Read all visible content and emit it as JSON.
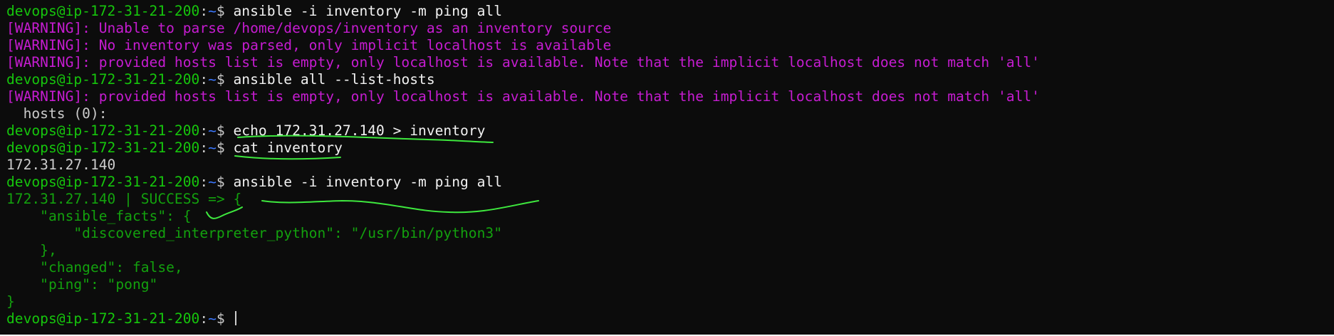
{
  "terminal": {
    "prompt": {
      "user_host": "devops@ip-172-31-21-200",
      "colon": ":",
      "path": "~",
      "dollar": "$ "
    },
    "lines": [
      {
        "kind": "prompt",
        "command": "ansible -i inventory -m ping all"
      },
      {
        "kind": "warning",
        "text": "[WARNING]: Unable to parse /home/devops/inventory as an inventory source"
      },
      {
        "kind": "warning",
        "text": "[WARNING]: No inventory was parsed, only implicit localhost is available"
      },
      {
        "kind": "warning",
        "text": "[WARNING]: provided hosts list is empty, only localhost is available. Note that the implicit localhost does not match 'all'"
      },
      {
        "kind": "prompt",
        "command": "ansible all --list-hosts"
      },
      {
        "kind": "warning",
        "text": "[WARNING]: provided hosts list is empty, only localhost is available. Note that the implicit localhost does not match 'all'"
      },
      {
        "kind": "output",
        "text": "  hosts (0):"
      },
      {
        "kind": "prompt",
        "command": "echo 172.31.27.140 > inventory"
      },
      {
        "kind": "prompt",
        "command": "cat inventory"
      },
      {
        "kind": "output",
        "text": "172.31.27.140"
      },
      {
        "kind": "prompt",
        "command": "ansible -i inventory -m ping all"
      },
      {
        "kind": "success",
        "text": "172.31.27.140 | SUCCESS => {"
      },
      {
        "kind": "success",
        "text": "    \"ansible_facts\": {"
      },
      {
        "kind": "success",
        "text": "        \"discovered_interpreter_python\": \"/usr/bin/python3\""
      },
      {
        "kind": "success",
        "text": "    },"
      },
      {
        "kind": "success",
        "text": "    \"changed\": false,"
      },
      {
        "kind": "success",
        "text": "    \"ping\": \"pong\""
      },
      {
        "kind": "success",
        "text": "}"
      },
      {
        "kind": "prompt",
        "command": "",
        "cursor": true
      }
    ]
  },
  "colors": {
    "background": "#0c0c0c",
    "user_host": "#16c60c",
    "path": "#3b78ff",
    "warning": "#c61cd1",
    "success": "#13a10e",
    "annotation": "#3ee83e"
  }
}
